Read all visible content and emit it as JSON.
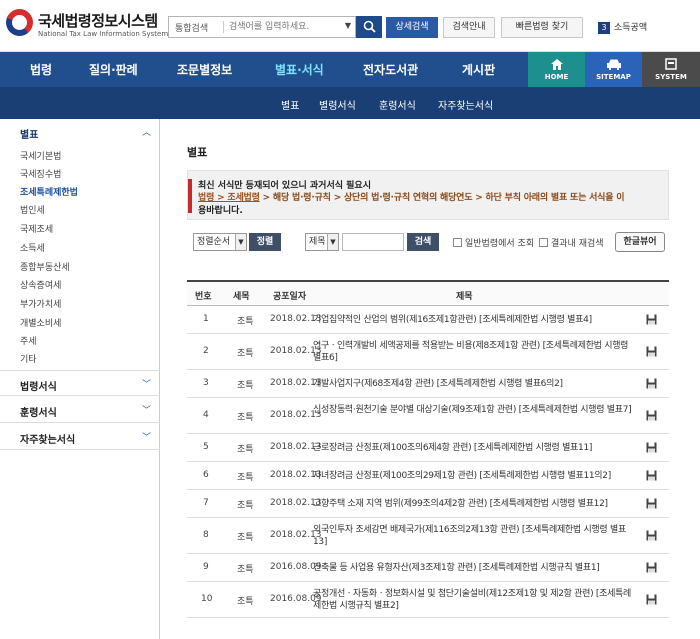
{
  "header": {
    "logo_ko": "국세법령정보시스템",
    "logo_en": "National Tax Law Information System",
    "search_select": "통합검색",
    "search_placeholder": "검색어를 입력하세요.",
    "btn_detail": "상세검색",
    "btn_guide": "검색안내",
    "btn_quick": "빠른법령 찾기",
    "login_num": "3",
    "login_text": "소득공액"
  },
  "nav": {
    "items": [
      "법령",
      "질의·판례",
      "조문별정보",
      "별표·서식",
      "전자도서관",
      "게시판"
    ],
    "active_index": 3,
    "quick": [
      "HOME",
      "SITEMAP",
      "SYSTEM"
    ]
  },
  "subnav": {
    "items": [
      "별표",
      "별령서식",
      "훈령서식",
      "자주찾는서식"
    ]
  },
  "sidebar": {
    "sections": [
      "별표",
      "법령서식",
      "훈령서식",
      "자주찾는서식"
    ],
    "items": [
      "국세기본법",
      "국세징수법",
      "조세특례제한법",
      "법인세",
      "국제조세",
      "소득세",
      "종합부동산세",
      "상속증여세",
      "부가가치세",
      "개별소비세",
      "주세",
      "기타"
    ],
    "active_item": "조세특례제한법"
  },
  "content": {
    "title": "별표",
    "notice_line1": "최신 서식만 등재되어 있으니 과거서식 필요시",
    "notice_line2_a": "법령 > 조세법령",
    "notice_line2_b": " > 해당 법·령·규칙 > 상단의 법·령·규칙 연혁의 해당연도 > 하단 부칙 아래의 별표 또는 서식을 이",
    "notice_line3": "용바랍니다.",
    "sort_select": "정렬순서",
    "sort_btn": "정렬",
    "field_select": "제목",
    "search_btn": "검색",
    "chk_general": "일반법령에서 조회",
    "chk_within": "결과내 재검색",
    "hangul_btn": "한글뷰어"
  },
  "table": {
    "headers": [
      "번호",
      "세목",
      "공포일자",
      "제목"
    ],
    "rows": [
      {
        "no": "1",
        "cat": "조특",
        "date": "2018.02.13",
        "title": "기업집약적인 산업의 범위(제16조제1항관련) [조세특례제한법 시행령 별표4]"
      },
      {
        "no": "2",
        "cat": "조특",
        "date": "2018.02.13",
        "title": "연구ㆍ인력개발비 세액공제를 적용받는 비용(제8조제1항 관련) [조세특례제한법 시행령 별표6]"
      },
      {
        "no": "3",
        "cat": "조특",
        "date": "2018.02.13",
        "title": "개발사업지구(제68조제4항 관련) [조세특례제한법 시행령 별표6의2]"
      },
      {
        "no": "4",
        "cat": "조특",
        "date": "2018.02.13",
        "title": "신성장동력·원천기술 분야별 대상기술(제9조제1항 관련) [조세특례제한법 시행령 별표7]"
      },
      {
        "no": "5",
        "cat": "조특",
        "date": "2018.02.13",
        "title": "근로장려금 산정표(제100조의6제4항 관련) [조세특례제한법 시행령 별표11]"
      },
      {
        "no": "6",
        "cat": "조특",
        "date": "2018.02.13",
        "title": "자녀장려금 산정표(제100조의29제1항 관련) [조세특례제한법 시행령 별표11의2]"
      },
      {
        "no": "7",
        "cat": "조특",
        "date": "2018.02.13",
        "title": "고향주택 소재 지역 범위(제99조의4제2항 관련) [조세특례제한법 시행령 별표12]"
      },
      {
        "no": "8",
        "cat": "조특",
        "date": "2018.02.13",
        "title": "외국인투자 조세감면 배제국가(제116조의2제13항 관련) [조세특례제한법 시행령 별표13]"
      },
      {
        "no": "9",
        "cat": "조특",
        "date": "2016.08.09",
        "title": "건축물 등 사업용 유형자산(제3조제1항 관련) [조세특례제한법 시행규칙 별표1]"
      },
      {
        "no": "10",
        "cat": "조특",
        "date": "2016.08.09",
        "title": "공정개선ㆍ자동화ㆍ정보화시설 및 첨단기술설비(제12조제1항 및 제2항 관련) [조세특례제한법 시행규칙 별표2]"
      }
    ]
  },
  "colors": {
    "nav_bg": "#214f8e",
    "subnav_bg": "#1a3f74",
    "home_bg": "#1e8f8f",
    "sitemap_bg": "#2a63b8",
    "system_bg": "#4b4b4b",
    "active_nav": "#7fe0ff"
  },
  "icons": {
    "search": "search-icon",
    "save": "floppy-disk-icon",
    "home": "home-icon",
    "sitemap": "car-icon",
    "system": "monitor-icon"
  }
}
